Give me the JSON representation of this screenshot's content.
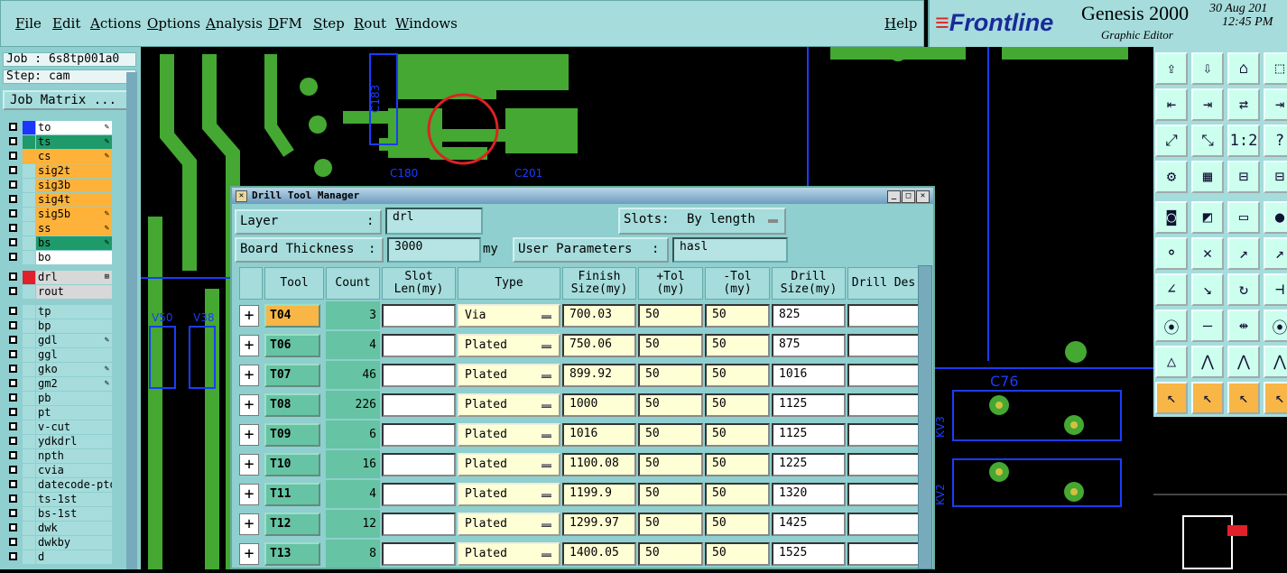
{
  "menu": [
    "File",
    "Edit",
    "Actions",
    "Options",
    "Analysis",
    "DFM",
    "Step",
    "Rout",
    "Windows"
  ],
  "help": "Help",
  "brand": {
    "logo": "Frontline",
    "product": "Genesis 2000",
    "subtitle": "Graphic Editor",
    "date": "30 Aug 201",
    "time": "12:45 PM"
  },
  "left": {
    "job": "Job : 6s8tp001a0",
    "step": "Step: cam",
    "job_matrix": "Job Matrix ...",
    "layers": [
      {
        "name": "to",
        "swatch": "#1c35ff",
        "bg": "#ffffff",
        "mark": "✎"
      },
      {
        "name": "ts",
        "swatch": "#1f9a6a",
        "bg": "#1f9a6a",
        "mark": "✎"
      },
      {
        "name": "cs",
        "swatch": "#ffb23a",
        "bg": "#ffb23a",
        "mark": "✎"
      },
      {
        "name": "sig2t",
        "swatch": "",
        "bg": "#ffb23a",
        "mark": ""
      },
      {
        "name": "sig3b",
        "swatch": "",
        "bg": "#ffb23a",
        "mark": ""
      },
      {
        "name": "sig4t",
        "swatch": "",
        "bg": "#ffb23a",
        "mark": ""
      },
      {
        "name": "sig5b",
        "swatch": "",
        "bg": "#ffb23a",
        "mark": "✎"
      },
      {
        "name": "ss",
        "swatch": "",
        "bg": "#ffb23a",
        "mark": "✎"
      },
      {
        "name": "bs",
        "swatch": "",
        "bg": "#1f9a6a",
        "mark": "✎"
      },
      {
        "name": "bo",
        "swatch": "",
        "bg": "#ffffff",
        "mark": ""
      },
      {
        "name": "drl",
        "swatch": "#e0202a",
        "bg": "#d8d8d8",
        "mark": "⊞"
      },
      {
        "name": "rout",
        "swatch": "",
        "bg": "#d8d8d8",
        "mark": ""
      },
      {
        "name": "tp",
        "swatch": "",
        "bg": "#a6dcdc",
        "mark": ""
      },
      {
        "name": "bp",
        "swatch": "",
        "bg": "#a6dcdc",
        "mark": ""
      },
      {
        "name": "gdl",
        "swatch": "",
        "bg": "#a6dcdc",
        "mark": "✎"
      },
      {
        "name": "ggl",
        "swatch": "",
        "bg": "#a6dcdc",
        "mark": ""
      },
      {
        "name": "gko",
        "swatch": "",
        "bg": "#a6dcdc",
        "mark": "✎"
      },
      {
        "name": "gm2",
        "swatch": "",
        "bg": "#a6dcdc",
        "mark": "✎"
      },
      {
        "name": "pb",
        "swatch": "",
        "bg": "#a6dcdc",
        "mark": ""
      },
      {
        "name": "pt",
        "swatch": "",
        "bg": "#a6dcdc",
        "mark": ""
      },
      {
        "name": "v-cut",
        "swatch": "",
        "bg": "#a6dcdc",
        "mark": ""
      },
      {
        "name": "ydkdrl",
        "swatch": "",
        "bg": "#a6dcdc",
        "mark": ""
      },
      {
        "name": "npth",
        "swatch": "",
        "bg": "#a6dcdc",
        "mark": ""
      },
      {
        "name": "cvia",
        "swatch": "",
        "bg": "#a6dcdc",
        "mark": ""
      },
      {
        "name": "datecode-pto",
        "swatch": "",
        "bg": "#a6dcdc",
        "mark": ""
      },
      {
        "name": "ts-1st",
        "swatch": "",
        "bg": "#a6dcdc",
        "mark": ""
      },
      {
        "name": "bs-1st",
        "swatch": "",
        "bg": "#a6dcdc",
        "mark": ""
      },
      {
        "name": "dwk",
        "swatch": "",
        "bg": "#a6dcdc",
        "mark": ""
      },
      {
        "name": "dwkby",
        "swatch": "",
        "bg": "#a6dcdc",
        "mark": ""
      },
      {
        "name": "d",
        "swatch": "",
        "bg": "#a6dcdc",
        "mark": ""
      }
    ]
  },
  "canvas_labels": {
    "c180": "C180",
    "c201": "C201",
    "c183": "C183",
    "c76": "C76",
    "v50": "V50",
    "v38": "V38",
    "kv3": "KV3",
    "kv2": "KV2"
  },
  "dialog": {
    "title": "Drill Tool Manager",
    "layer_label": "Layer",
    "layer_value": "drl",
    "slots_label": "Slots:",
    "slots_value": "By length",
    "thickness_label": "Board Thickness",
    "thickness_value": "3000",
    "thickness_unit": "my",
    "user_params_label": "User Parameters",
    "user_params_value": "hasl",
    "columns": [
      "Tool",
      "Count",
      "Slot Len(my)",
      "Type",
      "Finish Size(my)",
      "+Tol (my)",
      "-Tol (my)",
      "Drill Size(my)",
      "Drill Des"
    ],
    "rows": [
      {
        "tool": "T04",
        "count": "3",
        "type": "Via",
        "finish": "700.03",
        "ptol": "50",
        "mtol": "50",
        "drill": "825",
        "des": "",
        "selected": true
      },
      {
        "tool": "T06",
        "count": "4",
        "type": "Plated",
        "finish": "750.06",
        "ptol": "50",
        "mtol": "50",
        "drill": "875",
        "des": "",
        "selected": false
      },
      {
        "tool": "T07",
        "count": "46",
        "type": "Plated",
        "finish": "899.92",
        "ptol": "50",
        "mtol": "50",
        "drill": "1016",
        "des": "",
        "selected": false
      },
      {
        "tool": "T08",
        "count": "226",
        "type": "Plated",
        "finish": "1000",
        "ptol": "50",
        "mtol": "50",
        "drill": "1125",
        "des": "",
        "selected": false
      },
      {
        "tool": "T09",
        "count": "6",
        "type": "Plated",
        "finish": "1016",
        "ptol": "50",
        "mtol": "50",
        "drill": "1125",
        "des": "",
        "selected": false
      },
      {
        "tool": "T10",
        "count": "16",
        "type": "Plated",
        "finish": "1100.08",
        "ptol": "50",
        "mtol": "50",
        "drill": "1225",
        "des": "",
        "selected": false
      },
      {
        "tool": "T11",
        "count": "4",
        "type": "Plated",
        "finish": "1199.9",
        "ptol": "50",
        "mtol": "50",
        "drill": "1320",
        "des": "",
        "selected": false
      },
      {
        "tool": "T12",
        "count": "12",
        "type": "Plated",
        "finish": "1299.97",
        "ptol": "50",
        "mtol": "50",
        "drill": "1425",
        "des": "",
        "selected": false
      },
      {
        "tool": "T13",
        "count": "8",
        "type": "Plated",
        "finish": "1400.05",
        "ptol": "50",
        "mtol": "50",
        "drill": "1525",
        "des": "",
        "selected": false
      }
    ]
  },
  "tools": [
    [
      "⇪",
      "⇩",
      "⌂",
      "⬚"
    ],
    [
      "⇤",
      "⇥",
      "⇄",
      "⇥"
    ],
    [
      "⤢",
      "⤡",
      "1:2",
      "?"
    ],
    [
      "⚙",
      "▦",
      "⊟",
      "⊟"
    ],
    [
      "◙",
      "◩",
      "▭",
      "●"
    ],
    [
      "⚬",
      "✕",
      "↗",
      "↗"
    ],
    [
      "∠",
      "↘",
      "↻",
      "⊣"
    ],
    [
      "⦿",
      "—",
      "⇹",
      "⦿"
    ],
    [
      "△",
      "⋀",
      "⋀",
      "⋀"
    ],
    [
      "↖",
      "↖",
      "↖",
      "↖"
    ]
  ],
  "colors": {
    "panel": "#a6dcdc",
    "trace": "#44a832",
    "canvas": "#000000"
  }
}
